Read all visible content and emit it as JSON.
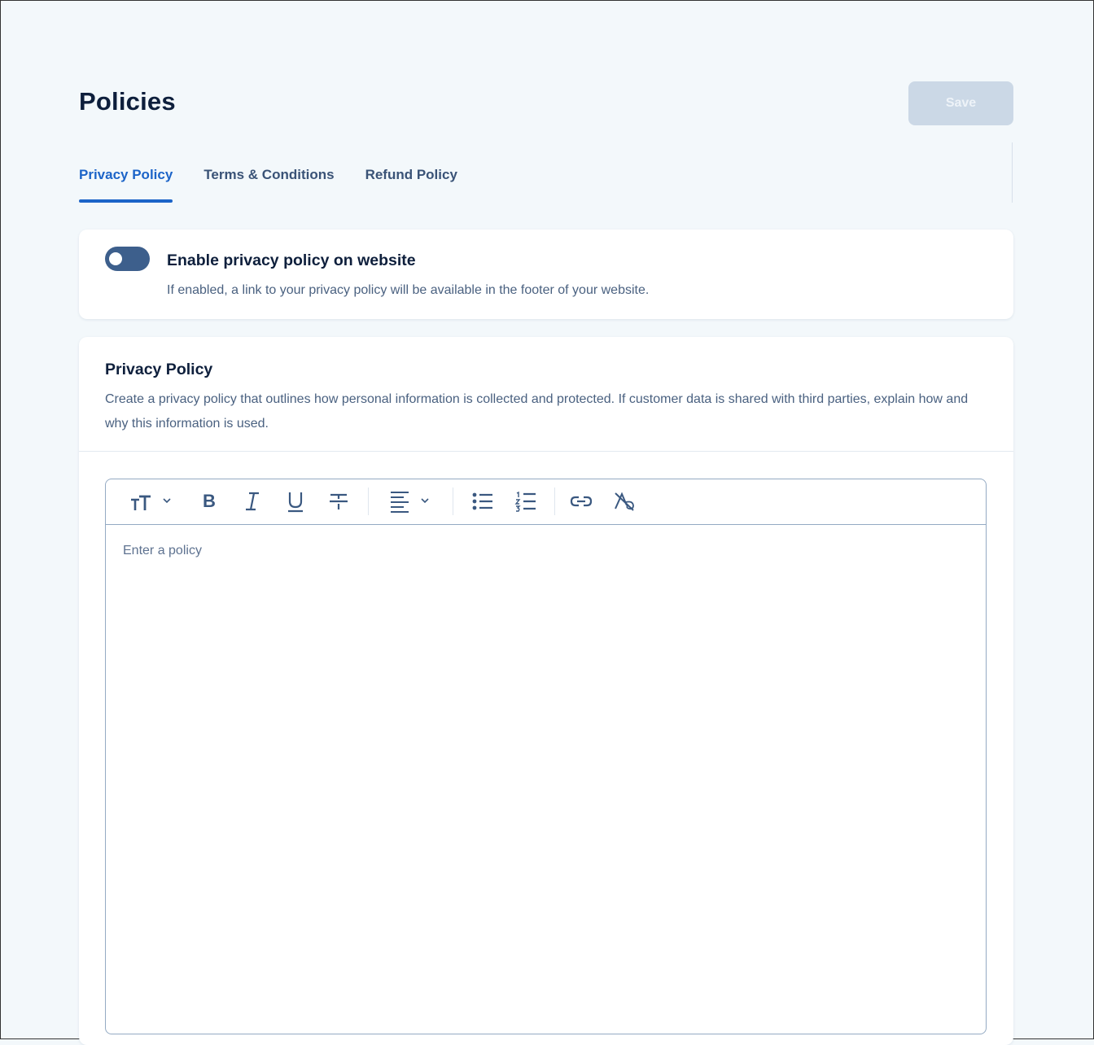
{
  "header": {
    "title": "Policies",
    "save_label": "Save"
  },
  "tabs": [
    {
      "label": "Privacy Policy",
      "active": true
    },
    {
      "label": "Terms & Conditions",
      "active": false
    },
    {
      "label": "Refund Policy",
      "active": false
    }
  ],
  "toggle_card": {
    "enabled": false,
    "title": "Enable privacy policy on website",
    "description": "If enabled, a link to your privacy policy will be available in the footer of your website."
  },
  "policy_section": {
    "title": "Privacy Policy",
    "description": "Create a privacy policy that outlines how personal information is collected and protected. If customer data is shared with third parties, explain how and why this information is used."
  },
  "editor": {
    "placeholder": "Enter a policy",
    "value": "",
    "toolbar": [
      "text-size-icon",
      "bold-icon",
      "italic-icon",
      "underline-icon",
      "strikethrough-icon",
      "align-left-icon",
      "bulleted-list-icon",
      "numbered-list-icon",
      "link-icon",
      "clear-formatting-icon"
    ],
    "toolbar_letters": {
      "bold": "B",
      "italic": "I",
      "underline": "U"
    }
  },
  "colors": {
    "accent": "#1c64c8",
    "page_background": "#f3f8fb",
    "save_disabled": "#cbd8e6",
    "toggle_off": "#3d5f8c"
  }
}
